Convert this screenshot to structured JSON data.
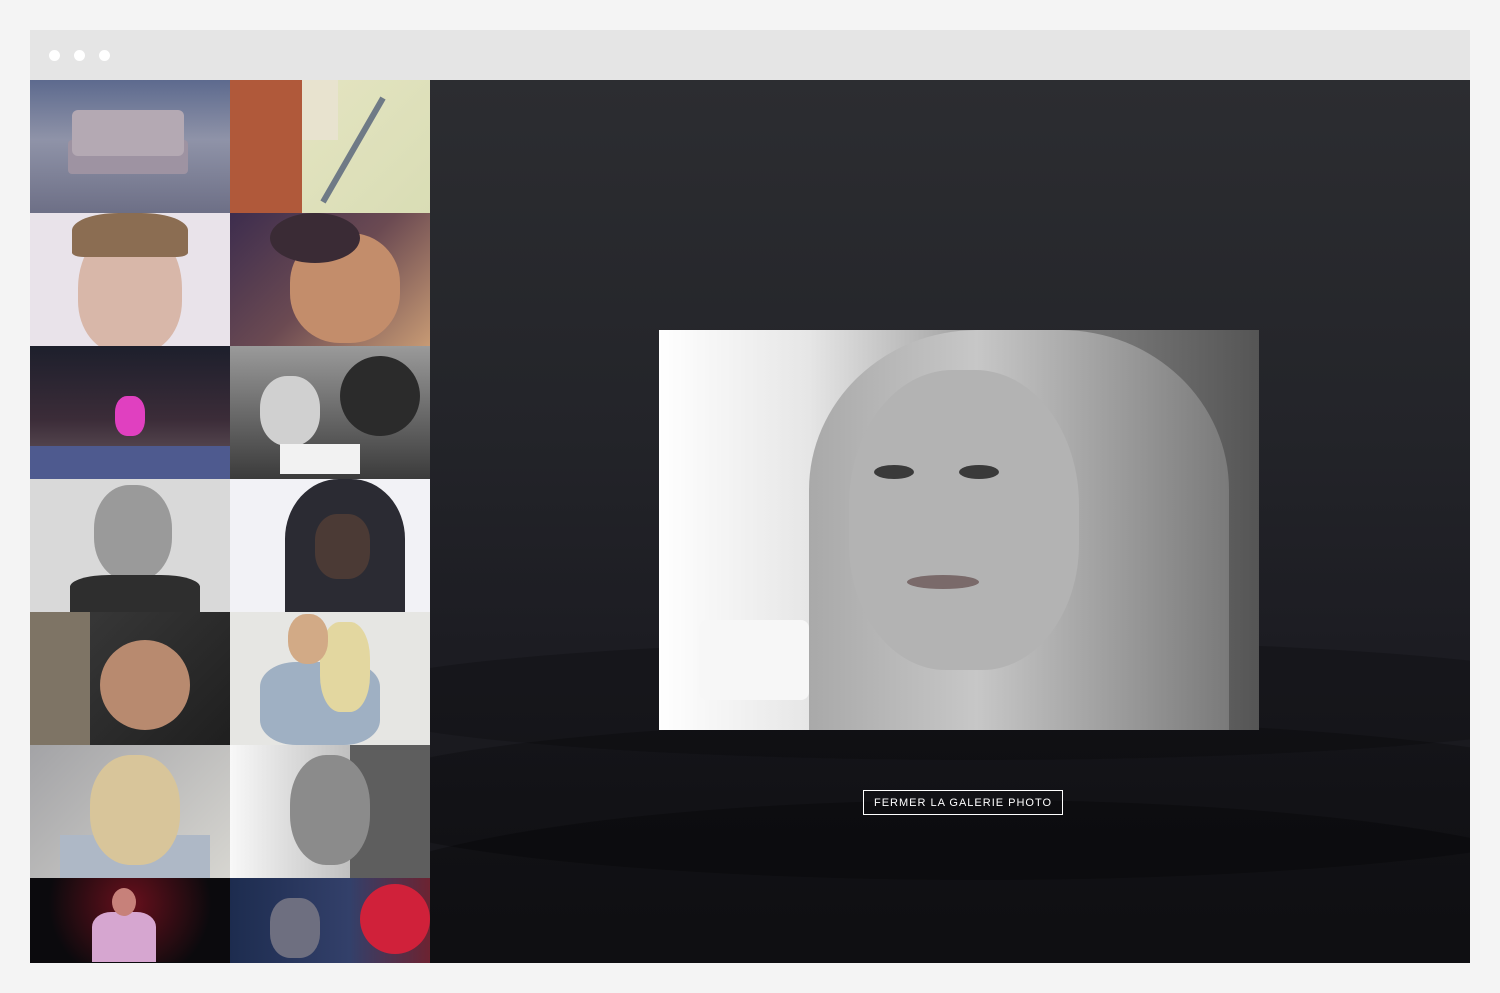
{
  "window": {
    "controls": [
      "window-dot",
      "window-dot",
      "window-dot"
    ]
  },
  "gallery": {
    "thumbnails": [
      {
        "name": "thumbnail-sofa-beach"
      },
      {
        "name": "thumbnail-building-facade"
      },
      {
        "name": "thumbnail-portrait-close-up"
      },
      {
        "name": "thumbnail-portrait-resting"
      },
      {
        "name": "thumbnail-breakdance-battle"
      },
      {
        "name": "thumbnail-winner-sign"
      },
      {
        "name": "thumbnail-portrait-man-bw"
      },
      {
        "name": "thumbnail-portrait-hoodie"
      },
      {
        "name": "thumbnail-baby"
      },
      {
        "name": "thumbnail-woman-seated"
      },
      {
        "name": "thumbnail-woman-looking-down"
      },
      {
        "name": "thumbnail-woman-bw"
      },
      {
        "name": "thumbnail-singer-stage"
      },
      {
        "name": "thumbnail-dj-stage"
      }
    ],
    "selected_index": 11
  },
  "viewer": {
    "close_label": "FERMER LA GALERIE PHOTO"
  },
  "colors": {
    "page_bg": "#f4f4f4",
    "titlebar": "#e5e5e5",
    "stage_bg": "#25272c",
    "button_border": "#ffffff"
  }
}
